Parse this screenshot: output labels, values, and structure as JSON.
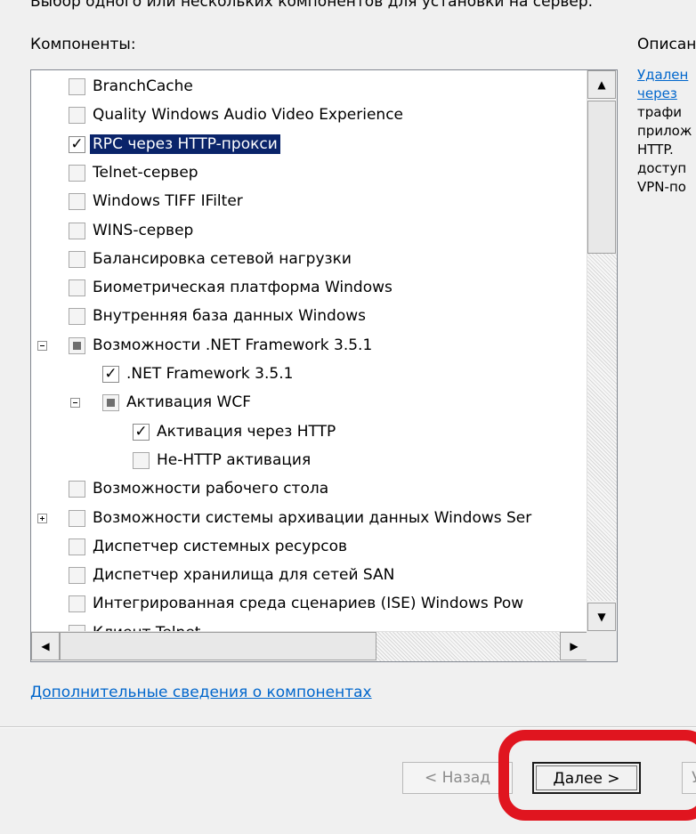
{
  "header": {
    "instruction": "Выбор одного или нескольких компонентов для установки на сервер.",
    "components_label": "Компоненты:",
    "description_label": "Описан"
  },
  "description": {
    "link_lines": [
      "Удален",
      "через"
    ],
    "text_lines": [
      "трафи",
      "прилож",
      "HTTP.",
      "доступ",
      "VPN-по"
    ]
  },
  "features": [
    {
      "label": "BranchCache",
      "state": "unchecked",
      "level": 0,
      "expander": ""
    },
    {
      "label": "Quality Windows Audio Video Experience",
      "state": "unchecked",
      "level": 0,
      "expander": ""
    },
    {
      "label": "RPC через HTTP-прокси",
      "state": "checked",
      "level": 0,
      "expander": "",
      "selected": true
    },
    {
      "label": "Telnet-сервер",
      "state": "unchecked",
      "level": 0,
      "expander": ""
    },
    {
      "label": "Windows TIFF IFilter",
      "state": "unchecked",
      "level": 0,
      "expander": ""
    },
    {
      "label": "WINS-сервер",
      "state": "unchecked",
      "level": 0,
      "expander": ""
    },
    {
      "label": "Балансировка сетевой нагрузки",
      "state": "unchecked",
      "level": 0,
      "expander": ""
    },
    {
      "label": "Биометрическая платформа Windows",
      "state": "unchecked",
      "level": 0,
      "expander": ""
    },
    {
      "label": "Внутренняя база данных Windows",
      "state": "unchecked",
      "level": 0,
      "expander": ""
    },
    {
      "label": "Возможности .NET Framework 3.5.1",
      "state": "partial",
      "level": 0,
      "expander": "minus"
    },
    {
      "label": ".NET Framework 3.5.1",
      "state": "checked",
      "level": 1,
      "expander": ""
    },
    {
      "label": "Активация WCF",
      "state": "partial",
      "level": 1,
      "expander": "minus"
    },
    {
      "label": "Активация через HTTP",
      "state": "checked",
      "level": 2,
      "expander": ""
    },
    {
      "label": "Не-HTTP активация",
      "state": "unchecked",
      "level": 2,
      "expander": ""
    },
    {
      "label": "Возможности рабочего стола",
      "state": "unchecked",
      "level": 0,
      "expander": ""
    },
    {
      "label": "Возможности системы архивации данных Windows Ser",
      "state": "unchecked",
      "level": 0,
      "expander": "plus"
    },
    {
      "label": "Диспетчер системных ресурсов",
      "state": "unchecked",
      "level": 0,
      "expander": ""
    },
    {
      "label": "Диспетчер хранилища для сетей SAN",
      "state": "unchecked",
      "level": 0,
      "expander": ""
    },
    {
      "label": "Интегрированная среда сценариев (ISE) Windows Pow",
      "state": "unchecked",
      "level": 0,
      "expander": ""
    },
    {
      "label": "Клиент Telnet",
      "state": "unchecked",
      "level": 0,
      "expander": ""
    }
  ],
  "scroll": {
    "up_glyph": "▲",
    "down_glyph": "▼",
    "left_glyph": "◀",
    "right_glyph": "▶"
  },
  "more_info_link": "Дополнительные сведения о компонентах",
  "buttons": {
    "back": "< Назад",
    "next": "Далее >",
    "partial": "У"
  },
  "colors": {
    "selection": "#0a246a",
    "link": "#0066cc",
    "highlight": "#e0151f"
  },
  "icons": {
    "checkmark": "✓"
  }
}
